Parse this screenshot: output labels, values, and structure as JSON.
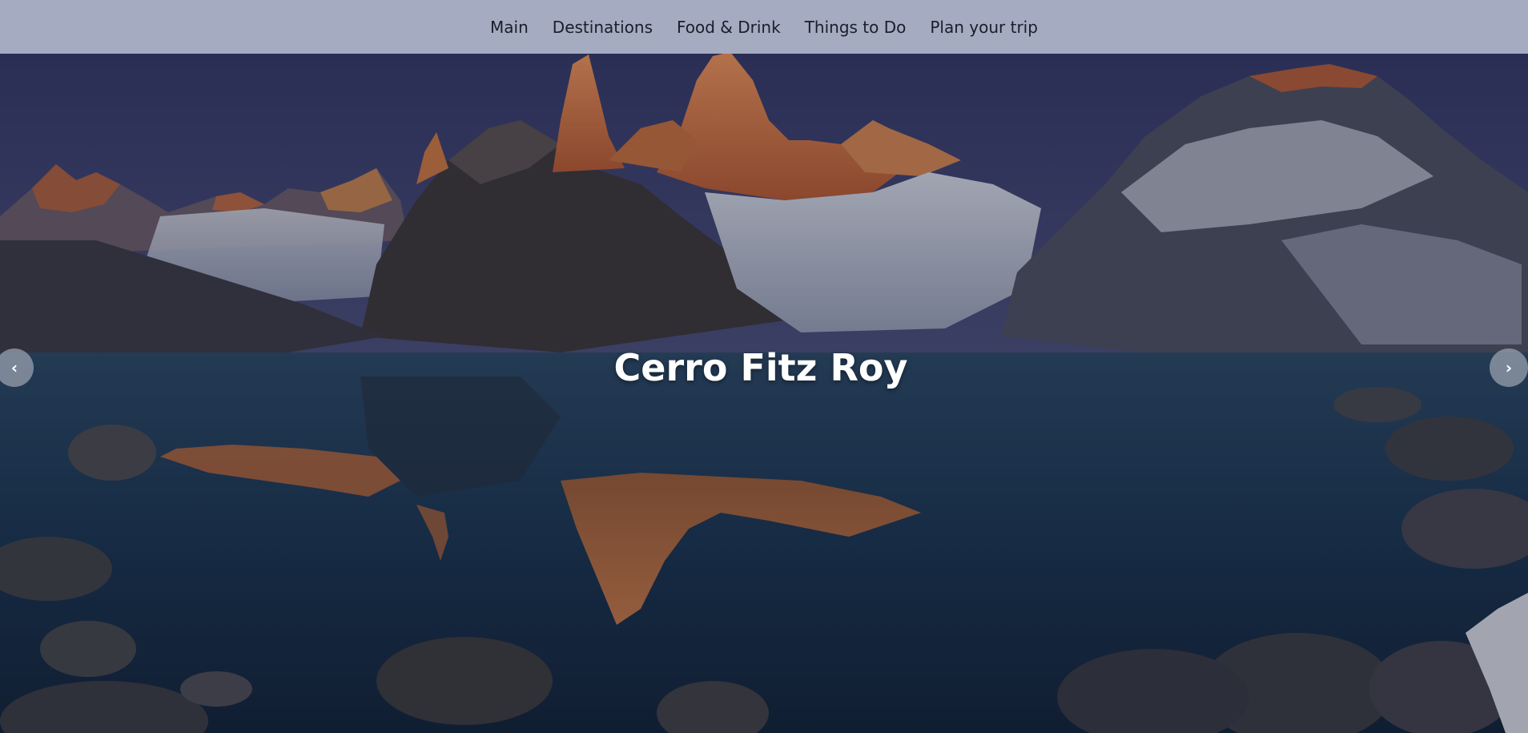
{
  "nav": {
    "items": [
      {
        "label": "Main"
      },
      {
        "label": "Destinations"
      },
      {
        "label": "Food & Drink"
      },
      {
        "label": "Things to Do"
      },
      {
        "label": "Plan your trip"
      }
    ]
  },
  "hero": {
    "title": "Cerro Fitz Roy",
    "prev_glyph": "‹",
    "next_glyph": "›",
    "prev_icon": "chevron-left-icon",
    "next_icon": "chevron-right-icon"
  },
  "colors": {
    "nav_bg": "#a5abc0",
    "nav_text": "#1b1e2a",
    "title": "#ffffff",
    "sky": "#363a66",
    "lake": "#1a3a5c",
    "peak_glow": "#d9733a"
  }
}
